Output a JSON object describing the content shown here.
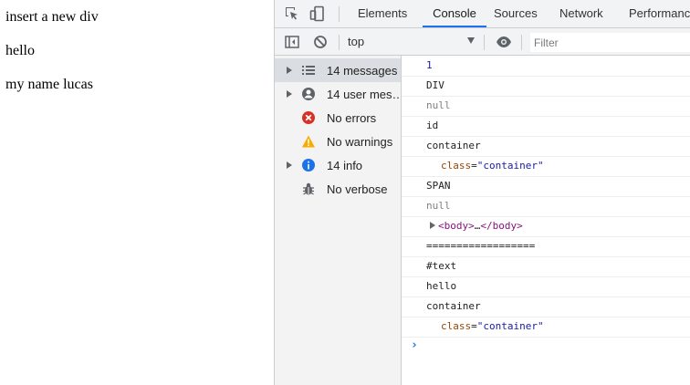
{
  "page": {
    "lines": [
      "insert a new div",
      "hello",
      "my name lucas"
    ]
  },
  "devtools": {
    "tabs": [
      "Elements",
      "Console",
      "Sources",
      "Network",
      "Performance"
    ],
    "active_tab": "Console",
    "context": "top",
    "filter_placeholder": "Filter",
    "sidebar": [
      {
        "label": "14 messages",
        "icon": "list-icon",
        "expandable": true,
        "selected": true
      },
      {
        "label": "14 user mes…",
        "icon": "user-icon",
        "expandable": true,
        "selected": false
      },
      {
        "label": "No errors",
        "icon": "error-icon",
        "expandable": false,
        "selected": false
      },
      {
        "label": "No warnings",
        "icon": "warning-icon",
        "expandable": false,
        "selected": false
      },
      {
        "label": "14 info",
        "icon": "info-icon",
        "expandable": true,
        "selected": false
      },
      {
        "label": "No verbose",
        "icon": "bug-icon",
        "expandable": false,
        "selected": false
      }
    ],
    "console_lines": [
      {
        "kind": "number",
        "text": "1"
      },
      {
        "kind": "text",
        "text": "DIV"
      },
      {
        "kind": "null",
        "text": "null"
      },
      {
        "kind": "text",
        "text": "id"
      },
      {
        "kind": "text",
        "text": "container"
      },
      {
        "kind": "attr",
        "attr": "class",
        "eq": "=",
        "value": "\"container\""
      },
      {
        "kind": "text",
        "text": "SPAN"
      },
      {
        "kind": "null",
        "text": "null"
      },
      {
        "kind": "element",
        "open": "<body>",
        "ellipsis": "…",
        "close": "</body>"
      },
      {
        "kind": "text",
        "text": "=================="
      },
      {
        "kind": "text",
        "text": "#text"
      },
      {
        "kind": "text",
        "text": "hello"
      },
      {
        "kind": "text",
        "text": "container"
      },
      {
        "kind": "attr",
        "attr": "class",
        "eq": "=",
        "value": "\"container\""
      }
    ],
    "prompt": "›"
  },
  "colors": {
    "accent": "#1a73e8",
    "error": "#d93025",
    "warning": "#f9ab00",
    "info": "#1a73e8"
  }
}
